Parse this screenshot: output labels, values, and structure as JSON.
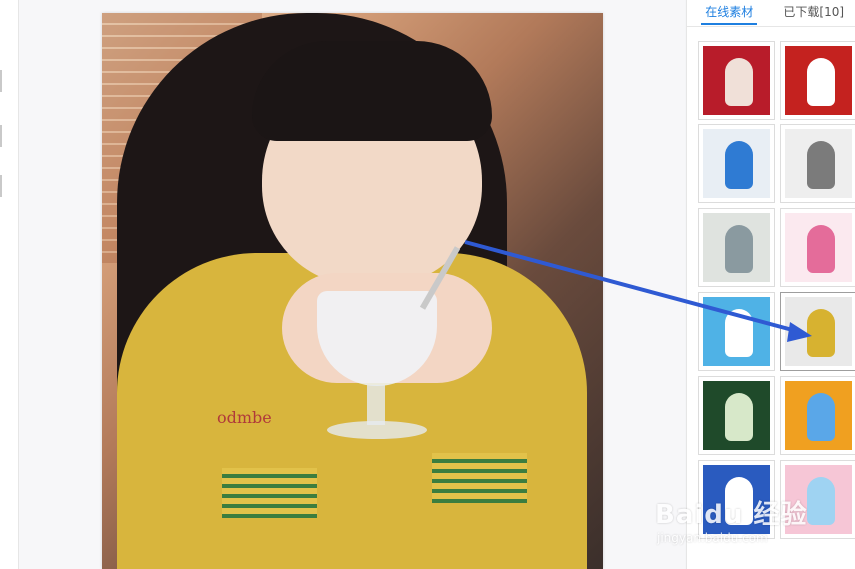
{
  "panel": {
    "tabs": [
      {
        "label": "在线素材",
        "active": true
      },
      {
        "label": "已下载[10]",
        "active": false
      }
    ],
    "tiles": [
      {
        "name": "template-red-poster",
        "bg": "#b81c2a",
        "fg": "#f0e0d8"
      },
      {
        "name": "template-stacked-frames",
        "bg": "#c4221f",
        "fg": "#ffffff"
      },
      {
        "name": "template-polaroid-photo",
        "bg": "#e8eef4",
        "fg": "#2f7bd3"
      },
      {
        "name": "template-grey-collage",
        "bg": "#eeeeee",
        "fg": "#7b7b7b"
      },
      {
        "name": "template-soft-portrait",
        "bg": "#dfe3df",
        "fg": "#8a9aa0"
      },
      {
        "name": "template-heart-frame",
        "bg": "#fbe9ef",
        "fg": "#e46c9a"
      },
      {
        "name": "template-blue-frame",
        "bg": "#4fb2e6",
        "fg": "#ffffff"
      },
      {
        "name": "template-yellow-dress",
        "bg": "#e9e9e9",
        "fg": "#d7b230"
      },
      {
        "name": "template-green-leaves",
        "bg": "#1f4a2a",
        "fg": "#d7e8c9"
      },
      {
        "name": "template-orange-blue",
        "bg": "#f0a020",
        "fg": "#5aa7e8"
      },
      {
        "name": "template-blue-cartoon",
        "bg": "#2a5bbf",
        "fg": "#ffffff"
      },
      {
        "name": "template-pastel-pink",
        "bg": "#f6c6d6",
        "fg": "#9fd3f2"
      }
    ]
  },
  "photo": {
    "chest_text": "odmbe"
  },
  "watermark": {
    "logo": "Baidu 经验",
    "site": "jingyan.baidu.com"
  },
  "colors": {
    "accent": "#1e7fe0",
    "arrow": "#2f5ad3"
  }
}
